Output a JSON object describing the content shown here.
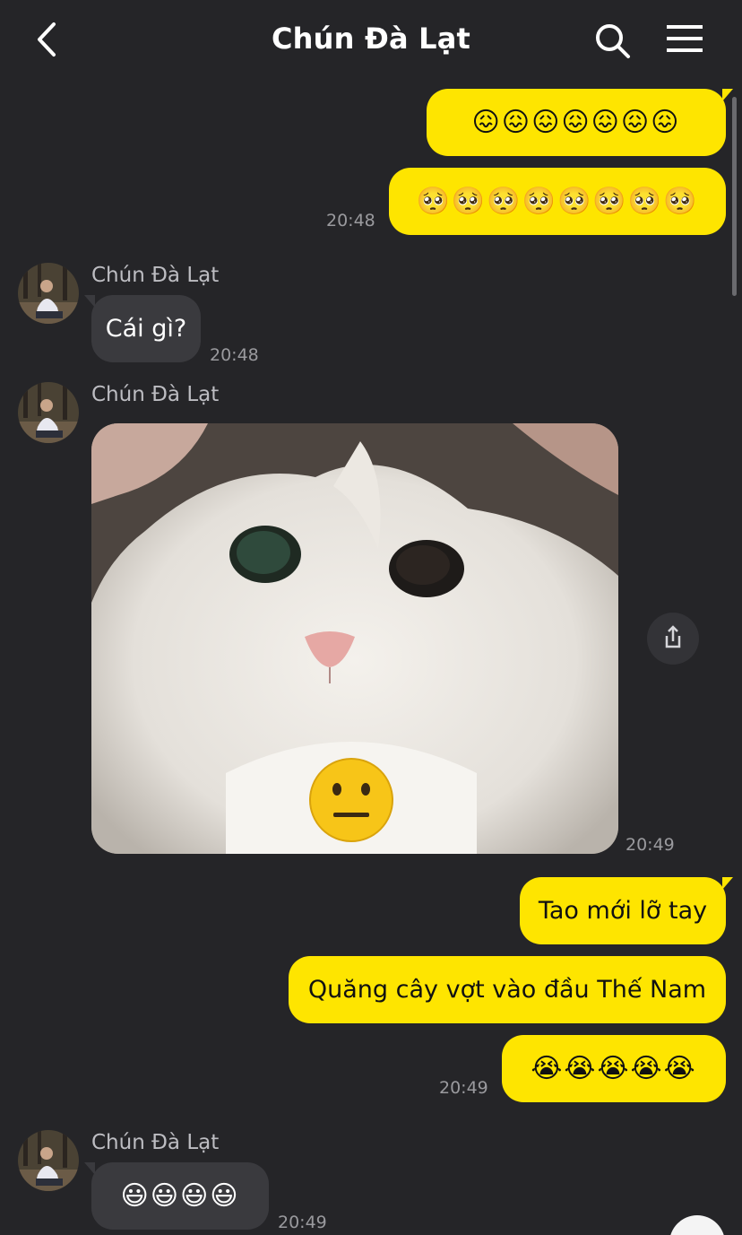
{
  "header": {
    "title": "Chún Đà Lạt",
    "back_icon": "chevron-left-icon",
    "search_icon": "search-icon",
    "menu_icon": "hamburger-menu-icon"
  },
  "colors": {
    "background": "#252528",
    "outgoing_bubble": "#fee500",
    "incoming_bubble": "#3a3a3e",
    "timestamp": "#9a9a9e"
  },
  "messages": [
    {
      "direction": "out",
      "text": "😖😖😖😖😖😖😖"
    },
    {
      "direction": "out",
      "text": "🥺🥺🥺🥺🥺🥺🥺🥺",
      "time": "20:48"
    },
    {
      "direction": "in",
      "sender": "Chún Đà Lạt",
      "text": "Cái gì?",
      "time": "20:48"
    },
    {
      "direction": "in",
      "sender": "Chún Đà Lạt",
      "type": "photo",
      "photo_emoji": "😐",
      "time": "20:49"
    },
    {
      "direction": "out",
      "text": "Tao mới lỡ tay"
    },
    {
      "direction": "out",
      "text": "Quăng cây vợt vào đầu Thế Nam"
    },
    {
      "direction": "out",
      "text": "😭😭😭😭😭",
      "time": "20:49"
    },
    {
      "direction": "in",
      "sender": "Chún Đà Lạt",
      "text": "😃😃😃😃",
      "time": "20:49"
    }
  ]
}
